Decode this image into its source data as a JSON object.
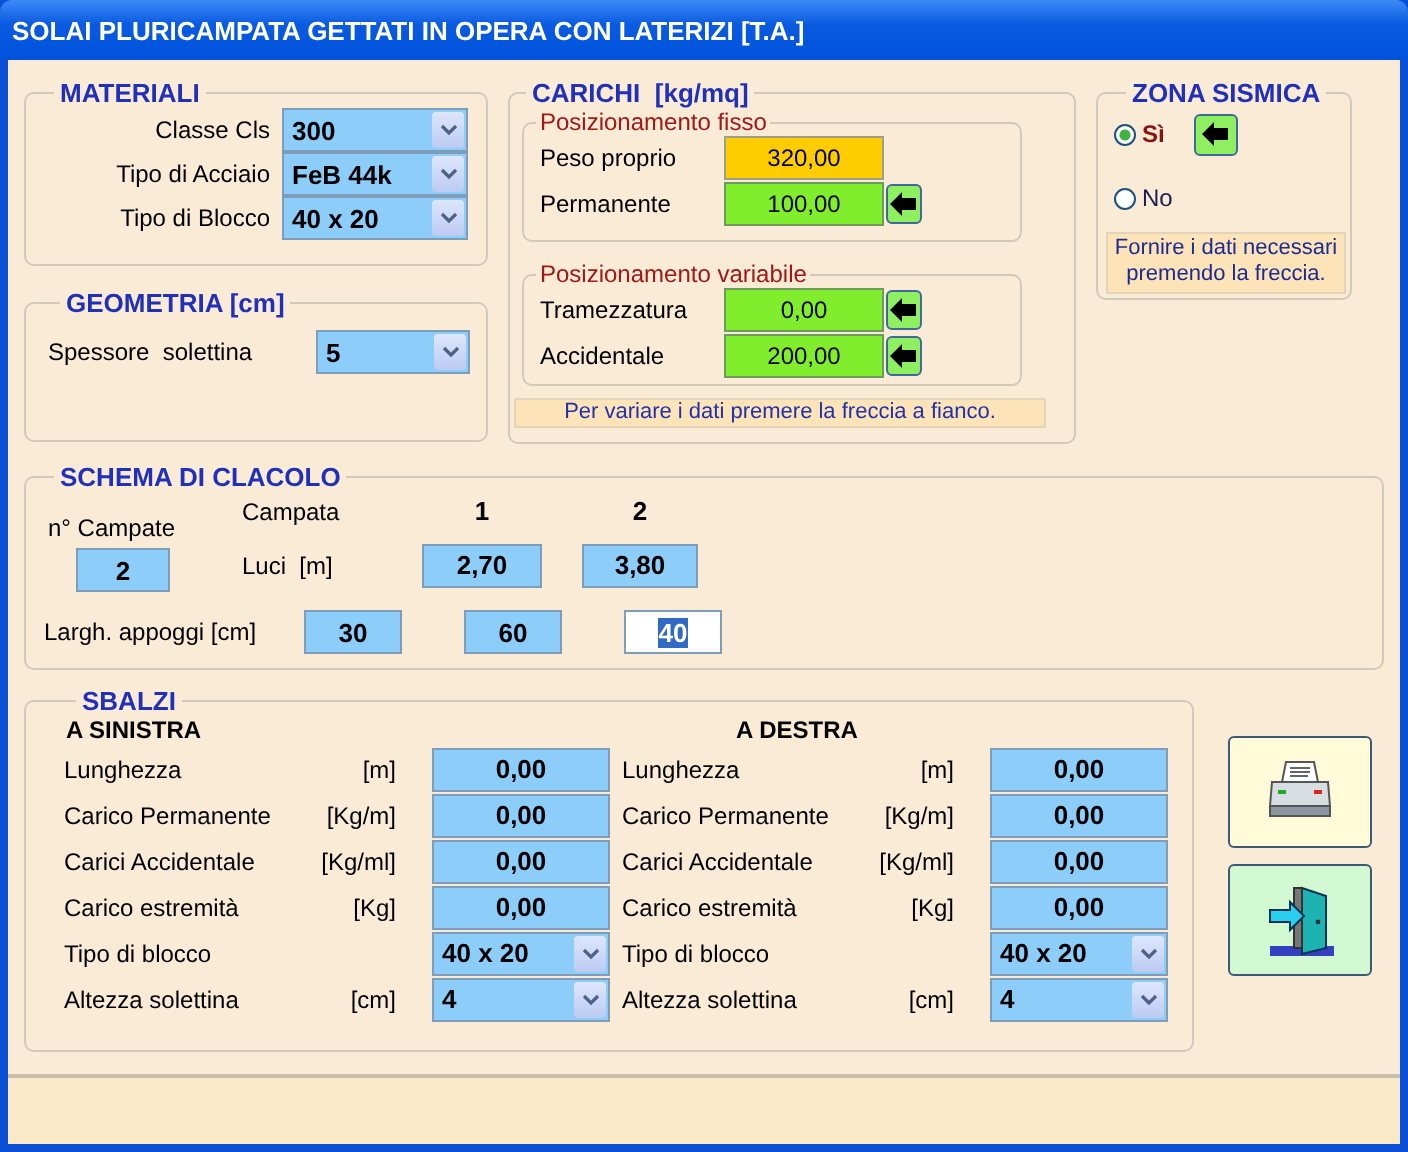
{
  "window": {
    "title": "SOLAI PLURICAMPATA GETTATI IN OPERA CON LATERIZI [T.A.]"
  },
  "materiali": {
    "title": "MATERIALI",
    "fields": [
      {
        "label": "Classe Cls",
        "value": "300"
      },
      {
        "label": "Tipo di Acciaio",
        "value": "FeB 44k"
      },
      {
        "label": "Tipo di Blocco",
        "value": "40 x 20"
      }
    ]
  },
  "geometria": {
    "title": "GEOMETRIA [cm]",
    "fields": [
      {
        "label": "Spessore  solettina",
        "value": "5"
      }
    ]
  },
  "carichi": {
    "title": "CARICHI  [kg/mq]",
    "groups": [
      {
        "title": "Posizionamento fisso",
        "rows": [
          {
            "label": "Peso proprio",
            "value": "320,00",
            "kind": "computed"
          },
          {
            "label": "Permanente",
            "value": "100,00",
            "kind": "editable"
          }
        ]
      },
      {
        "title": "Posizionamento variabile",
        "rows": [
          {
            "label": "Tramezzatura",
            "value": "0,00",
            "kind": "editable"
          },
          {
            "label": "Accidentale",
            "value": "200,00",
            "kind": "editable"
          }
        ]
      }
    ],
    "hint": "Per variare i dati premere la freccia a fianco."
  },
  "zona_sismica": {
    "title": "ZONA SISMICA",
    "options": [
      {
        "label": "Sì",
        "selected": true
      },
      {
        "label": "No",
        "selected": false
      }
    ],
    "hint": "Fornire i dati necessari premendo la freccia."
  },
  "schema": {
    "title": "SCHEMA DI CLACOLO",
    "campate_label": "n° Campate",
    "campate_value": "2",
    "campata_label": "Campata",
    "luci_label": "Luci  [m]",
    "spans": [
      {
        "number": "1",
        "luce": "2,70"
      },
      {
        "number": "2",
        "luce": "3,80"
      }
    ],
    "appoggi_label": "Largh. appoggi [cm]",
    "appoggi": [
      {
        "value": "30",
        "focused": false
      },
      {
        "value": "60",
        "focused": false
      },
      {
        "value": "40",
        "focused": true
      }
    ]
  },
  "sbalzi": {
    "title": "SBALZI",
    "sides": [
      {
        "heading": "A SINISTRA",
        "rows": [
          {
            "label": "Lunghezza",
            "unit": "[m]",
            "value": "0,00",
            "kind": "field"
          },
          {
            "label": "Carico Permanente",
            "unit": "[Kg/m]",
            "value": "0,00",
            "kind": "field"
          },
          {
            "label": "Carici Accidentale",
            "unit": "[Kg/ml]",
            "value": "0,00",
            "kind": "field"
          },
          {
            "label": "Carico estremità",
            "unit": "[Kg]",
            "value": "0,00",
            "kind": "field"
          },
          {
            "label": "Tipo di blocco",
            "value": "40 x 20",
            "kind": "combo"
          },
          {
            "label": "Altezza solettina",
            "unit": "[cm]",
            "value": "4",
            "kind": "combo"
          }
        ]
      },
      {
        "heading": "A DESTRA",
        "rows": [
          {
            "label": "Lunghezza",
            "unit": "[m]",
            "value": "0,00",
            "kind": "field"
          },
          {
            "label": "Carico Permanente",
            "unit": "[Kg/m]",
            "value": "0,00",
            "kind": "field"
          },
          {
            "label": "Carici Accidentale",
            "unit": "[Kg/ml]",
            "value": "0,00",
            "kind": "field"
          },
          {
            "label": "Carico estremità",
            "unit": "[Kg]",
            "value": "0,00",
            "kind": "field"
          },
          {
            "label": "Tipo di blocco",
            "value": "40 x 20",
            "kind": "combo"
          },
          {
            "label": "Altezza solettina",
            "unit": "[cm]",
            "value": "4",
            "kind": "combo"
          }
        ]
      }
    ]
  },
  "buttons": [
    {
      "kind": "print"
    },
    {
      "kind": "exit"
    }
  ]
}
